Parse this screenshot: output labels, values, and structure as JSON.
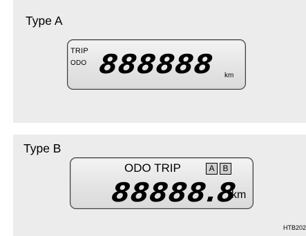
{
  "type_a": {
    "label": "Type A",
    "trip_label": "TRIP",
    "odo_label": "ODO",
    "digits": "888888",
    "unit": "km"
  },
  "type_b": {
    "label": "Type B",
    "mode_label": "ODO TRIP",
    "box_a": "A",
    "box_b": "B",
    "digits": "88888.8",
    "unit": "km"
  },
  "figure_code": "HTB202"
}
